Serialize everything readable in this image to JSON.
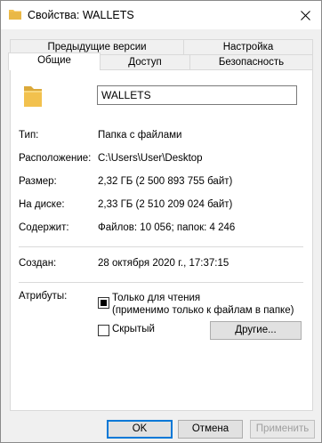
{
  "window": {
    "title": "Свойства: WALLETS"
  },
  "tabs_row_top": [
    {
      "label": "Предыдущие версии"
    },
    {
      "label": "Настройка"
    }
  ],
  "tabs_row_bottom": [
    {
      "label": "Общие",
      "active": true
    },
    {
      "label": "Доступ"
    },
    {
      "label": "Безопасность"
    }
  ],
  "general": {
    "name": "WALLETS",
    "type_label": "Тип:",
    "type_value": "Папка с файлами",
    "location_label": "Расположение:",
    "location_value": "C:\\Users\\User\\Desktop",
    "size_label": "Размер:",
    "size_value": "2,32 ГБ (2 500 893 755 байт)",
    "disk_label": "На диске:",
    "disk_value": "2,33 ГБ (2 510 209 024 байт)",
    "contains_label": "Содержит:",
    "contains_value": "Файлов: 10 056; папок: 4 246",
    "created_label": "Создан:",
    "created_value": "28 октября 2020 г., 17:37:15",
    "attributes_label": "Атрибуты:",
    "readonly_label": "Только для чтения",
    "readonly_note": "(применимо только к файлам в папке)",
    "readonly_state": "indeterminate",
    "hidden_label": "Скрытый",
    "hidden_checked": false,
    "other_button": "Другие..."
  },
  "footer": {
    "ok": "OK",
    "cancel": "Отмена",
    "apply": "Применить"
  },
  "colors": {
    "folder": "#f2c14e",
    "folder_dark": "#dba93a",
    "default_button_border": "#0078d7"
  }
}
